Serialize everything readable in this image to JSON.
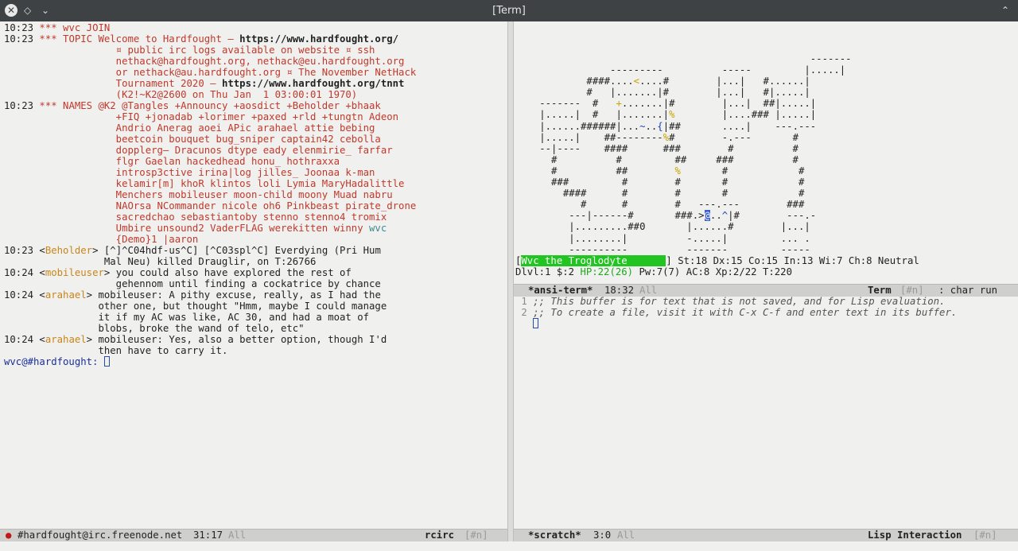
{
  "window": {
    "title": "[Term]",
    "icons": [
      "close-icon",
      "diamond-icon",
      "chevron-down-icon",
      "chevron-up-icon"
    ]
  },
  "irc": {
    "lines": [
      {
        "time": "10:23",
        "text": " *** wvc JOIN"
      },
      {
        "time": "10:23",
        "text": " *** TOPIC Welcome to Hardfought – ",
        "bold": "https://www.hardfought.org/"
      },
      {
        "time": "",
        "text": "              ¤ public irc logs available on website ¤ ssh"
      },
      {
        "time": "",
        "text": "              nethack@hardfought.org, nethack@eu.hardfought.org"
      },
      {
        "time": "",
        "text": "              or nethack@au.hardfought.org ¤ The November NetHack"
      },
      {
        "time": "",
        "text": "              Tournament 2020 – ",
        "bold": "https://www.hardfought.org/tnnt"
      },
      {
        "time": "",
        "text": "              (K2!~K2@2600 on Thu Jan  1 03:00:01 1970)"
      },
      {
        "time": "10:23",
        "text": " *** NAMES @K2 @Tangles +Announcy +aosdict +Beholder +bhaak"
      },
      {
        "time": "",
        "text": "              +FIQ +jonadab +lorimer +paxed +rld +tungtn Adeon"
      },
      {
        "time": "",
        "text": "              Andrio Anerag aoei APic arahael attie bebing"
      },
      {
        "time": "",
        "text": "              beetcoin bouquet bug_sniper captain42 cebolla"
      },
      {
        "time": "",
        "text": "              dopplerg– Dracunos dtype eady elenmirie_ farfar"
      },
      {
        "time": "",
        "text": "              flgr Gaelan hackedhead honu_ hothraxxa"
      },
      {
        "time": "",
        "text": "              introsp3ctive irina|log jilles_ Joonaa k-man"
      },
      {
        "time": "",
        "text": "              kelamir[m] khoR klintos loli Lymia MaryHadalittle"
      },
      {
        "time": "",
        "text": "              Menchers mobileuser moon-child moony Muad nabru"
      },
      {
        "time": "",
        "text": "              NAOrsa NCommander nicole oh6 Pinkbeast pirate_drone"
      },
      {
        "time": "",
        "text": "              sacredchao sebastiantoby stenno stenno4 tromix"
      },
      {
        "time": "",
        "text": "              Umbire unsound2 VaderFLAG werekitten winny ",
        "teal": "wvc"
      },
      {
        "time": "",
        "text": "              {Demo}1 |aaron"
      }
    ],
    "messages": [
      {
        "time": "10:23",
        "nick": "Beholder",
        "lines": [
          "[^]^C04hdf-us^C] [^C03spl^C] Everdying (Pri Hum",
          "Mal Neu) killed Drauglir, on T:26766"
        ]
      },
      {
        "time": "10:24",
        "nick": "mobileuser",
        "lines": [
          "you could also have explored the rest of",
          "gehennom until finding a cockatrice by chance"
        ]
      },
      {
        "time": "10:24",
        "nick": "arahael",
        "lines": [
          "mobileuser: A pithy excuse, really, as I had the",
          "other one, but thought \"Hmm, maybe I could manage",
          "it if my AC was like, AC 30, and had a moat of",
          "blobs, broke the wand of telo, etc\""
        ]
      },
      {
        "time": "10:24",
        "nick": "arahael",
        "lines": [
          "mobileuser: Yes, also a better option, though I'd",
          "then have to carry it."
        ]
      }
    ],
    "prompt": "wvc@#hardfought:"
  },
  "modeline_left": {
    "bullet": "●",
    "buffer": "#hardfought@irc.freenode.net",
    "position": "31:17",
    "all": "All",
    "mode": "rcirc",
    "tag": "[#n]"
  },
  "nethack": {
    "map": [
      "                                                 -------",
      "               ---------          -----         |.....|",
      "           ####....<....#        |...|   #......|",
      "           #   |.......|#        |...|   #|.....|",
      "   -------  #   +.......|#        |...|  ##|.....|",
      "   |.....|  #   |.......|%        |....### |.....|",
      "   |......######|...~..{|##       ....|    ---.---",
      "   |.....|    ##--------%#        -.---       #",
      "   --|----    ####      ###        #          #",
      "     #          #         ##     ###          #",
      "     #          ##        %       #            #",
      "     ###         #        #       #            #",
      "       ####      #        #       #            #",
      "          #      #        #   ---.---        ###",
      "        ---|------#       ###.>@..^|#        ---.-",
      "        |.........##0       |......#        |...|",
      "        |........|          -.....|         ... .",
      "        ----------          -------         -----"
    ],
    "status_name": "Wvc the Troglodyte",
    "status_line1": "] St:18 Dx:15 Co:15 In:13 Wi:7 Ch:8 Neutral",
    "status_line2_pre": "Dlvl:1 $:2 ",
    "status_hp": "HP:22(26)",
    "status_line2_post": " Pw:7(7) AC:8 Xp:2/22 T:220"
  },
  "modeline_term": {
    "buffer": "*ansi-term*",
    "time": "18:32",
    "all": "All",
    "mode": "Term",
    "tag": "[#n]",
    "extra": ": char run"
  },
  "scratch": {
    "lines": [
      {
        "num": "1",
        "text": ";; This buffer is for text that is not saved, and for Lisp evaluation."
      },
      {
        "num": "2",
        "text": ";; To create a file, visit it with C-x C-f and enter text in its buffer."
      }
    ]
  },
  "modeline_scratch": {
    "buffer": "*scratch*",
    "position": "3:0",
    "all": "All",
    "mode": "Lisp Interaction",
    "tag": "[#n]"
  }
}
